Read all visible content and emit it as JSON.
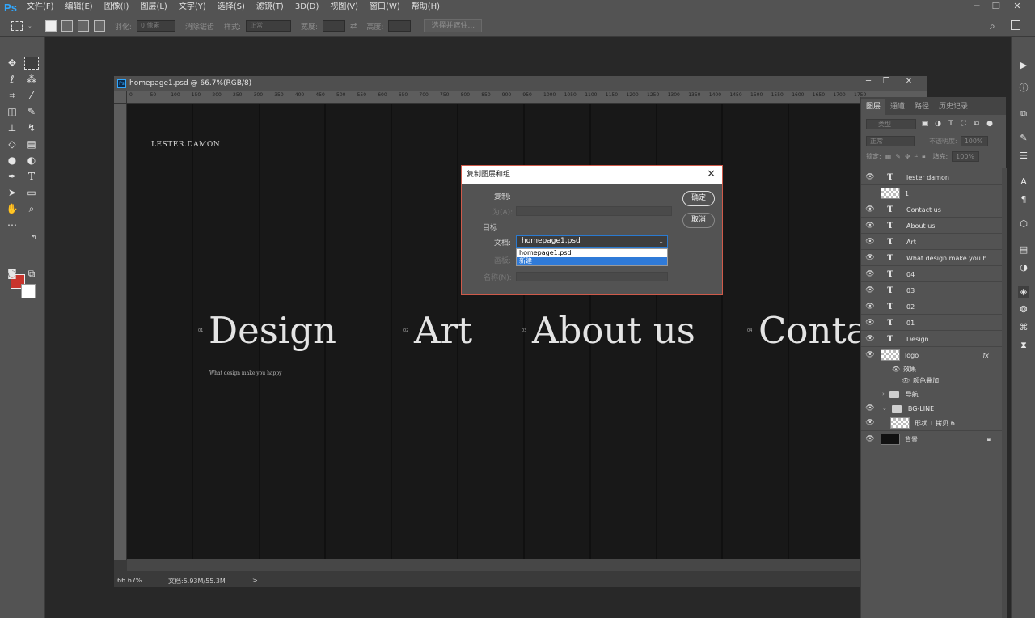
{
  "menubar": {
    "logo": "Ps",
    "items": [
      "文件(F)",
      "编辑(E)",
      "图像(I)",
      "图层(L)",
      "文字(Y)",
      "选择(S)",
      "滤镜(T)",
      "3D(D)",
      "视图(V)",
      "窗口(W)",
      "帮助(H)"
    ],
    "window_controls": [
      "─",
      "❐",
      "✕"
    ]
  },
  "options_bar": {
    "feather_label": "羽化:",
    "feather_value": "0 像素",
    "antialias_label": "消除锯齿",
    "style_label": "样式:",
    "style_value": "正常",
    "width_label": "宽度:",
    "height_label": "高度:",
    "select_mask_button": "选择并遮住..."
  },
  "document": {
    "tab_title": "homepage1.psd @ 66.7%(RGB/8)",
    "ruler_marks": [
      "0",
      "50",
      "100",
      "150",
      "200",
      "250",
      "300",
      "350",
      "400",
      "450",
      "500",
      "550",
      "600",
      "650",
      "700",
      "750",
      "800",
      "850",
      "900",
      "950",
      "1000",
      "1050",
      "1100",
      "1150",
      "1200",
      "1250",
      "1300",
      "1350",
      "1400",
      "1450",
      "1500",
      "1550",
      "1600",
      "1650",
      "1700",
      "1750"
    ],
    "zoom": "66.67%",
    "doc_info": "文档:5.93M/55.3M",
    "status_arrow": ">",
    "canvas": {
      "logo": "LESTER.DAMON",
      "nav": [
        {
          "num": "01",
          "label": "Design"
        },
        {
          "num": "02",
          "label": "Art"
        },
        {
          "num": "03",
          "label": "About us"
        },
        {
          "num": "04",
          "label": "Conta"
        }
      ],
      "subtext": "What design make you happy"
    }
  },
  "dialog": {
    "title": "复制图层和组",
    "close": "✕",
    "copy_label": "复制:",
    "as_label": "为(A):",
    "target_label": "目标",
    "document_label": "文档:",
    "document_value": "homepage1.psd",
    "artboard_label": "画板:",
    "name_label": "名称(N):",
    "ok_button": "确定",
    "cancel_button": "取消",
    "options": [
      "homepage1.psd",
      "新建"
    ],
    "selected_option": "新建"
  },
  "layers_panel": {
    "tabs": [
      "图层",
      "通道",
      "路径",
      "历史记录"
    ],
    "search_placeholder": "类型",
    "blend_mode": "正常",
    "opacity_label": "不透明度:",
    "opacity_value": "100%",
    "lock_label": "锁定:",
    "fill_label": "填充:",
    "fill_value": "100%",
    "layers": [
      {
        "type": "text",
        "name": "lester damon",
        "visible": true
      },
      {
        "type": "image",
        "name": "1",
        "visible": false
      },
      {
        "type": "text",
        "name": "Contact us",
        "visible": true
      },
      {
        "type": "text",
        "name": "About us",
        "visible": true
      },
      {
        "type": "text",
        "name": "Art",
        "visible": true
      },
      {
        "type": "text",
        "name": "What design make you h...",
        "visible": true
      },
      {
        "type": "text",
        "name": "04",
        "visible": true
      },
      {
        "type": "text",
        "name": "03",
        "visible": true
      },
      {
        "type": "text",
        "name": "02",
        "visible": true
      },
      {
        "type": "text",
        "name": "01",
        "visible": true
      },
      {
        "type": "text",
        "name": "Design",
        "visible": true
      },
      {
        "type": "image",
        "name": "logo",
        "visible": true,
        "fx": "fx"
      }
    ],
    "effects_label": "效果",
    "color_overlay_label": "颜色叠加",
    "group_nav": "导航",
    "group_bgline": "BG-LINE",
    "shape_layer": "形状 1 拷贝 6",
    "background_layer": "背景",
    "type_glyph": "T"
  }
}
